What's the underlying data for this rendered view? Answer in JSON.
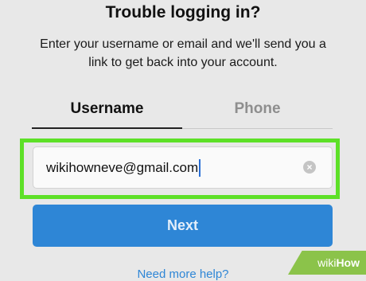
{
  "header": {
    "title": "Trouble logging in?",
    "description": "Enter your username or email and we'll send you a link to get back into your account."
  },
  "tabs": [
    {
      "label": "Username",
      "active": true
    },
    {
      "label": "Phone",
      "active": false
    }
  ],
  "field": {
    "value": "wikihowneve@gmail.com",
    "clear_icon": "clear-circle-icon"
  },
  "next_button": {
    "label": "Next"
  },
  "help": {
    "label": "Need more help?"
  },
  "watermark": {
    "part1": "wiki",
    "part2": "How"
  },
  "colors": {
    "accent": "#2e86d6",
    "highlight": "#5de027",
    "background": "#e8e8e8"
  }
}
